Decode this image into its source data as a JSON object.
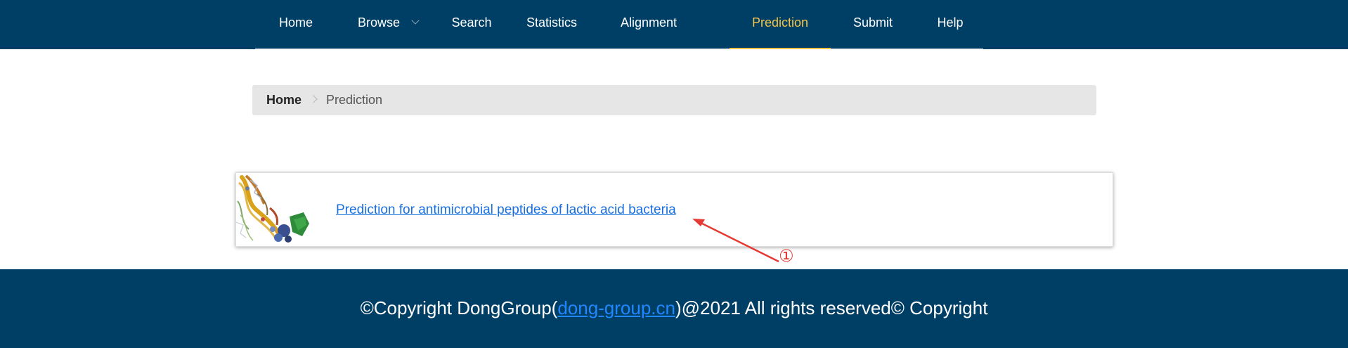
{
  "nav": {
    "items": [
      {
        "label": "Home"
      },
      {
        "label": "Browse"
      },
      {
        "label": "Search"
      },
      {
        "label": "Statistics"
      },
      {
        "label": "Alignment"
      },
      {
        "label": "Prediction",
        "active": true
      },
      {
        "label": "Submit"
      },
      {
        "label": "Help"
      }
    ]
  },
  "breadcrumb": {
    "home": "Home",
    "current": "Prediction"
  },
  "card": {
    "link_text": "Prediction for antimicrobial peptides of lactic acid bacteria"
  },
  "annotation": {
    "marker": "①"
  },
  "footer": {
    "prefix": "©Copyright DongGroup(",
    "link": "dong-group.cn",
    "suffix": ")@2021 All rights reserved© Copyright"
  },
  "colors": {
    "brand_navy": "#003f65",
    "active_gold": "#f6c445",
    "link_blue": "#1a6fe0",
    "annotation_red": "#e53935"
  }
}
